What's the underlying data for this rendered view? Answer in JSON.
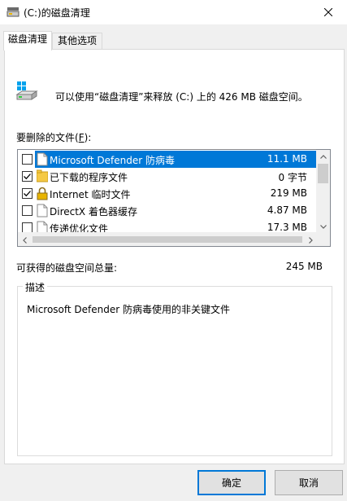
{
  "window": {
    "title": "(C:)的磁盘清理",
    "title_icon": "disk-cleanup-icon",
    "close_icon": "close-icon"
  },
  "tabs": [
    {
      "label": "磁盘清理",
      "active": true
    },
    {
      "label": "其他选项",
      "active": false
    }
  ],
  "intro": {
    "text": "可以使用“磁盘清理”来释放  (C:) 上的 426 MB 磁盘空间。",
    "icon": "drive-icon"
  },
  "files": {
    "label_before": "要删除的文件(",
    "label_mnemonic": "F",
    "label_after": "):",
    "items": [
      {
        "name": "Microsoft Defender 防病毒",
        "size": "11.1 MB",
        "checked": false,
        "selected": true,
        "icon": "file-icon"
      },
      {
        "name": "已下载的程序文件",
        "size": "0 字节",
        "checked": true,
        "selected": false,
        "icon": "folder-icon"
      },
      {
        "name": "Internet 临时文件",
        "size": "219 MB",
        "checked": true,
        "selected": false,
        "icon": "lock-icon"
      },
      {
        "name": "DirectX 着色器缓存",
        "size": "4.87 MB",
        "checked": false,
        "selected": false,
        "icon": "file-icon"
      },
      {
        "name": "传递优化文件",
        "size": "17.3 MB",
        "checked": false,
        "selected": false,
        "icon": "file-icon"
      }
    ]
  },
  "total": {
    "label": "可获得的磁盘空间总量:",
    "value": "245 MB"
  },
  "description": {
    "legend": "描述",
    "text": "Microsoft Defender 防病毒使用的非关键文件"
  },
  "buttons": {
    "ok": "确定",
    "cancel": "取消"
  },
  "colors": {
    "selection": "#0078d7",
    "face": "#f0f0f0",
    "default_button_border": "#0078d7"
  }
}
